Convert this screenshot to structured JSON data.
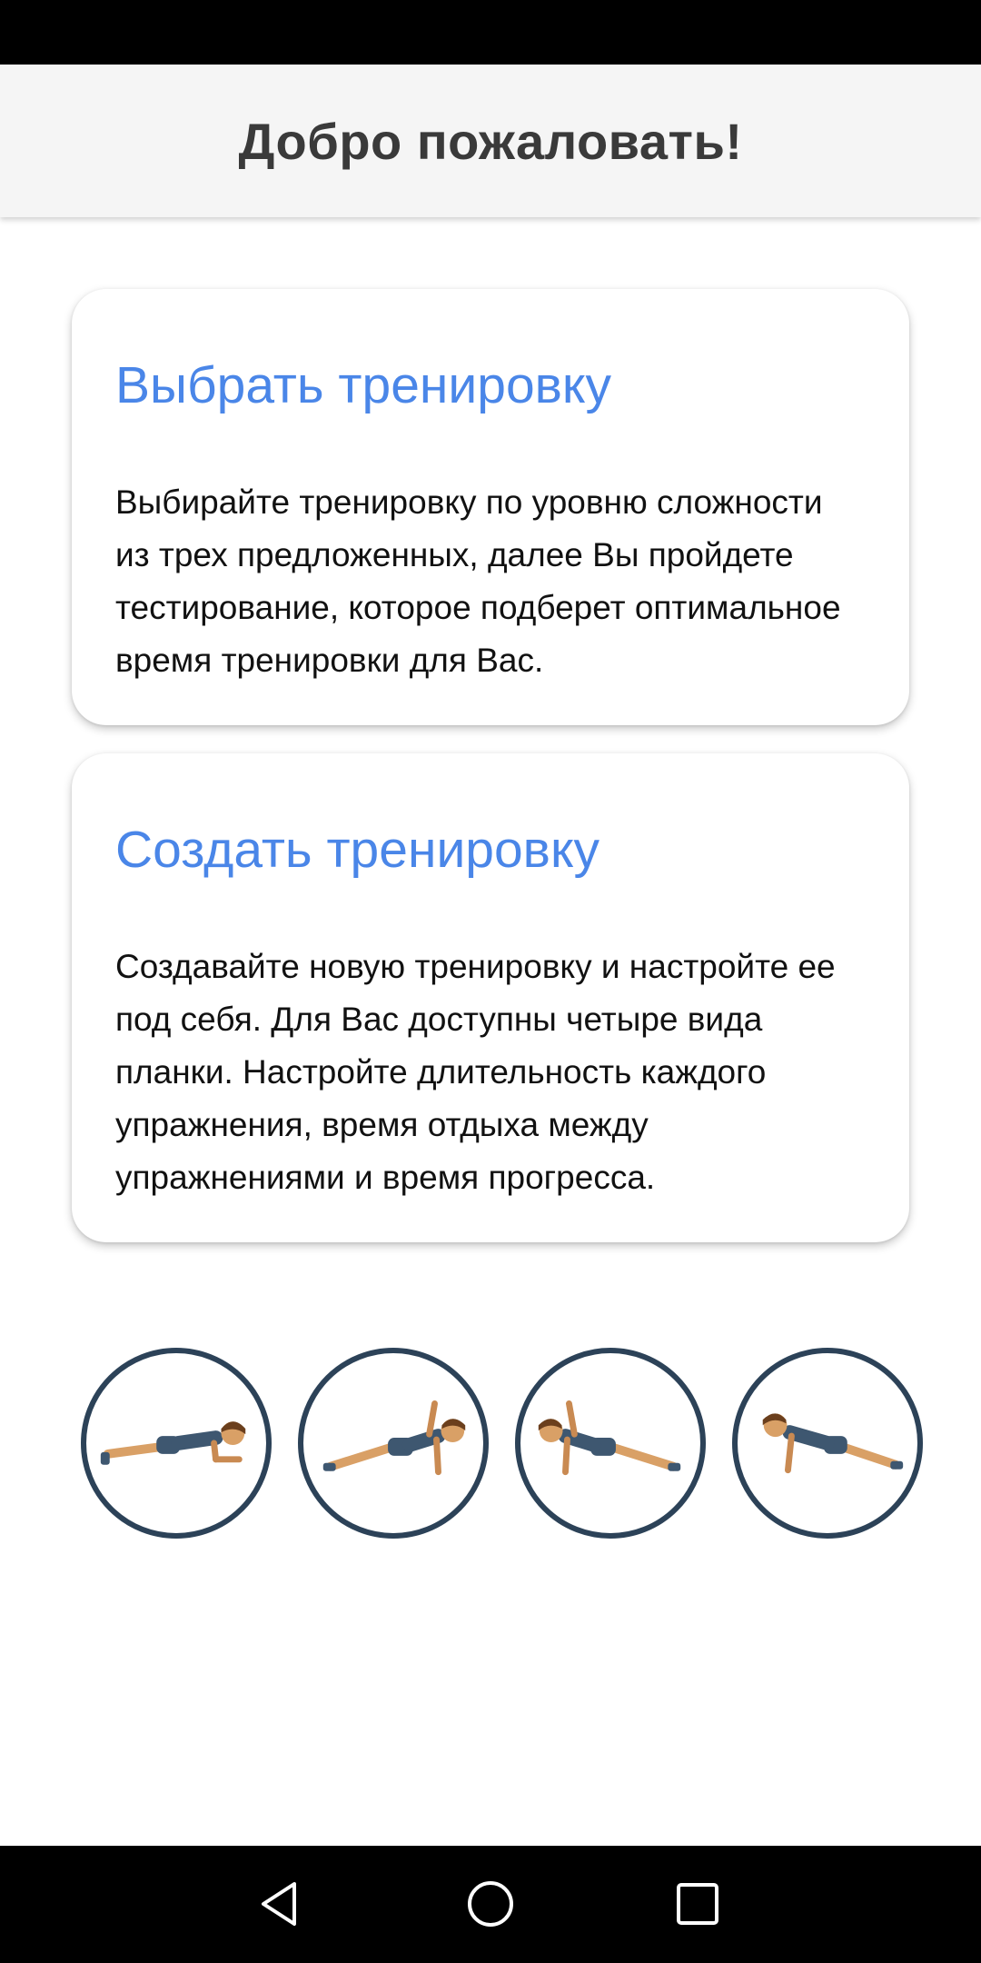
{
  "app_bar": {
    "title": "Добро пожаловать!"
  },
  "cards": [
    {
      "title": "Выбрать тренировку",
      "text": "Выбирайте тренировку по уровню сложности из трех предложенных, далее Вы пройдете тестирование, которое подберет оптимальное время тренировки для Вас."
    },
    {
      "title": "Создать тренировку",
      "text": "Создавайте новую тренировку и настройте ее под себя. Для Вас доступны четыре вида планки. Настройте длительность каждого упражнения, время отдыха между упражнениями и время прогресса."
    }
  ],
  "exercises": [
    {
      "icon": "forearm-plank-icon"
    },
    {
      "icon": "side-plank-right-icon"
    },
    {
      "icon": "side-plank-left-icon"
    },
    {
      "icon": "high-plank-icon"
    }
  ],
  "nav": {
    "icons": [
      "back-icon",
      "home-icon",
      "recents-icon"
    ]
  },
  "colors": {
    "accent": "#4a86e8",
    "circle_border": "#2c4258",
    "app_bar_bg": "#f5f5f5",
    "title_text": "#3a3a3a"
  }
}
